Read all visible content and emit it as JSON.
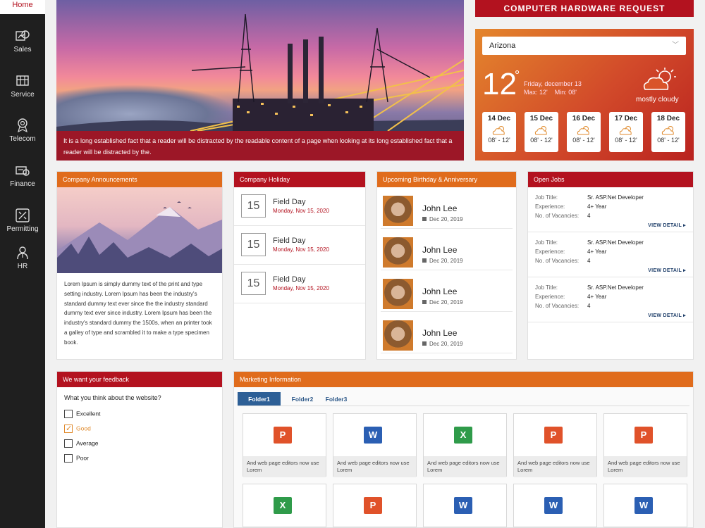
{
  "sidebar": {
    "home": "Home",
    "items": [
      {
        "label": "Sales",
        "icon": "sales-icon"
      },
      {
        "label": "Service",
        "icon": "service-icon"
      },
      {
        "label": "Telecom",
        "icon": "telecom-icon"
      },
      {
        "label": "Finance",
        "icon": "finance-icon"
      },
      {
        "label": "Permitting",
        "icon": "permitting-icon"
      },
      {
        "label": "HR",
        "icon": "hr-icon"
      }
    ]
  },
  "hero": {
    "caption": "It is a long established fact that a reader will be distracted by the readable content of a page when looking at its long established fact that a reader will be distracted by the."
  },
  "chr_button": "COMPUTER HARDWARE REQUEST",
  "weather": {
    "location": "Arizona",
    "temp": "12",
    "deg": "°",
    "date": "Friday, december 13",
    "minmax": "Max: 12'    Min: 08'",
    "condition": "mostly cloudy",
    "forecast": [
      {
        "day": "14 Dec",
        "range": "08' - 12'"
      },
      {
        "day": "15 Dec",
        "range": "08' - 12'"
      },
      {
        "day": "16 Dec",
        "range": "08' - 12'"
      },
      {
        "day": "17 Dec",
        "range": "08' - 12'"
      },
      {
        "day": "18 Dec",
        "range": "08' - 12'"
      }
    ]
  },
  "announcements": {
    "title": "Company Announcements",
    "text": "Lorem Ipsum is simply dummy text of the print and type setting industry. Lorem Ipsum has been the industry's standard dummy text ever since the the industry standard dummy text ever since industry. Lorem Ipsum has been the industry's standard dummy the 1500s, when an printer took a galley of type and scrambled it to make a type specimen book."
  },
  "holiday": {
    "title": "Company Holiday",
    "items": [
      {
        "num": "15",
        "name": "Field Day",
        "date": "Monday, Nov 15, 2020"
      },
      {
        "num": "15",
        "name": "Field Day",
        "date": "Monday, Nov 15, 2020"
      },
      {
        "num": "15",
        "name": "Field Day",
        "date": "Monday, Nov 15, 2020"
      }
    ]
  },
  "birthday": {
    "title": "Upcoming Birthday & Anniversary",
    "items": [
      {
        "name": "John Lee",
        "date": "Dec 20, 2019"
      },
      {
        "name": "John Lee",
        "date": "Dec 20, 2019"
      },
      {
        "name": "John Lee",
        "date": "Dec 20, 2019"
      },
      {
        "name": "John Lee",
        "date": "Dec 20, 2019"
      }
    ]
  },
  "jobs": {
    "title": "Open Jobs",
    "labels": {
      "title": "Job Title:",
      "exp": "Experience:",
      "vac": "No. of Vacancies:",
      "view": "VIEW DETAIL ▸"
    },
    "items": [
      {
        "title": "Sr. ASP.Net Developer",
        "exp": "4+ Year",
        "vac": "4"
      },
      {
        "title": "Sr. ASP.Net Developer",
        "exp": "4+ Year",
        "vac": "4"
      },
      {
        "title": "Sr. ASP.Net Developer",
        "exp": "4+ Year",
        "vac": "4"
      }
    ]
  },
  "feedback": {
    "title": "We want your feedback",
    "question": "What you think about the website?",
    "options": [
      {
        "label": "Excellent",
        "checked": false
      },
      {
        "label": "Good",
        "checked": true
      },
      {
        "label": "Average",
        "checked": false
      },
      {
        "label": "Poor",
        "checked": false
      }
    ]
  },
  "marketing": {
    "title": "Marketing Information",
    "tabs": [
      "Folder1",
      "Folder2",
      "Folder3"
    ],
    "caption": "And web page editors now use Lorem",
    "tiles_row1": [
      "P",
      "W",
      "X",
      "P",
      "P"
    ],
    "tiles_row2": [
      "X",
      "P",
      "W",
      "W",
      "W"
    ]
  },
  "colors": {
    "brand_red": "#b3121f",
    "brand_orange": "#e06c1c",
    "ppt": "#e0522a",
    "word": "#2b5fb3",
    "excel": "#2f9b4a"
  }
}
